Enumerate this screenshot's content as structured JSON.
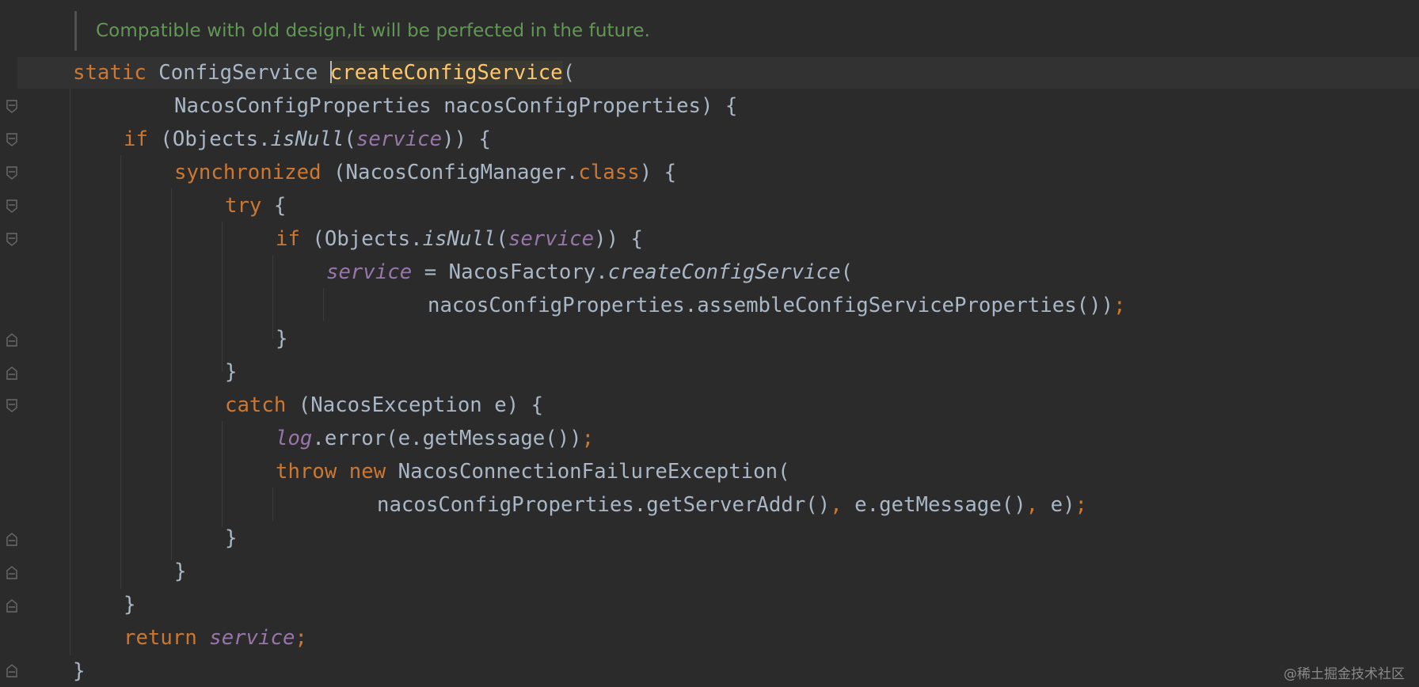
{
  "doc_comment": "Compatible with old design,It will be perfected in the future.",
  "code": {
    "l1": {
      "kw_static": "static",
      "type": " ConfigService ",
      "method": "createConfigService",
      "rest": "("
    },
    "l2": {
      "text": "NacosConfigProperties nacosConfigProperties) {"
    },
    "l3": {
      "kw_if": "if",
      "a": " (Objects.",
      "m": "isNull",
      "b": "(",
      "f": "service",
      "c": ")) {"
    },
    "l4": {
      "kw": "synchronized",
      "a": " (NacosConfigManager.",
      "kw_class": "class",
      "b": ") {"
    },
    "l5": {
      "kw": "try",
      "a": " {"
    },
    "l6": {
      "kw_if": "if",
      "a": " (Objects.",
      "m": "isNull",
      "b": "(",
      "f": "service",
      "c": ")) {"
    },
    "l7": {
      "f": "service",
      "a": " = NacosFactory.",
      "m": "createConfigService",
      "b": "("
    },
    "l8": {
      "a": "nacosConfigProperties.assembleConfigServiceProperties())",
      "semi": ";"
    },
    "l9": {
      "a": "}"
    },
    "l10": {
      "a": "}"
    },
    "l11": {
      "kw": "catch",
      "a": " (NacosException e) {"
    },
    "l12": {
      "f": "log",
      "a": ".error(e.getMessage())",
      "semi": ";"
    },
    "l13": {
      "kw_throw": "throw",
      "sp": " ",
      "kw_new": "new",
      "a": " NacosConnectionFailureException("
    },
    "l14": {
      "a": "nacosConfigProperties.getServerAddr()",
      "c1": ",",
      "b": " e.getMessage()",
      "c2": ",",
      "c": " e)",
      "semi": ";"
    },
    "l15": {
      "a": "}"
    },
    "l16": {
      "a": "}"
    },
    "l17": {
      "a": "}"
    },
    "l18": {
      "kw": "return",
      "sp": " ",
      "f": "service",
      "semi": ";"
    },
    "l19": {
      "a": "}"
    }
  },
  "watermark": "@稀土掘金技术社区",
  "colors": {
    "background": "#2b2b2b",
    "keyword": "#cc7832",
    "method_declaration": "#ffc66d",
    "field": "#9876aa",
    "default_text": "#a9b7c6",
    "doc_comment": "#629755"
  }
}
